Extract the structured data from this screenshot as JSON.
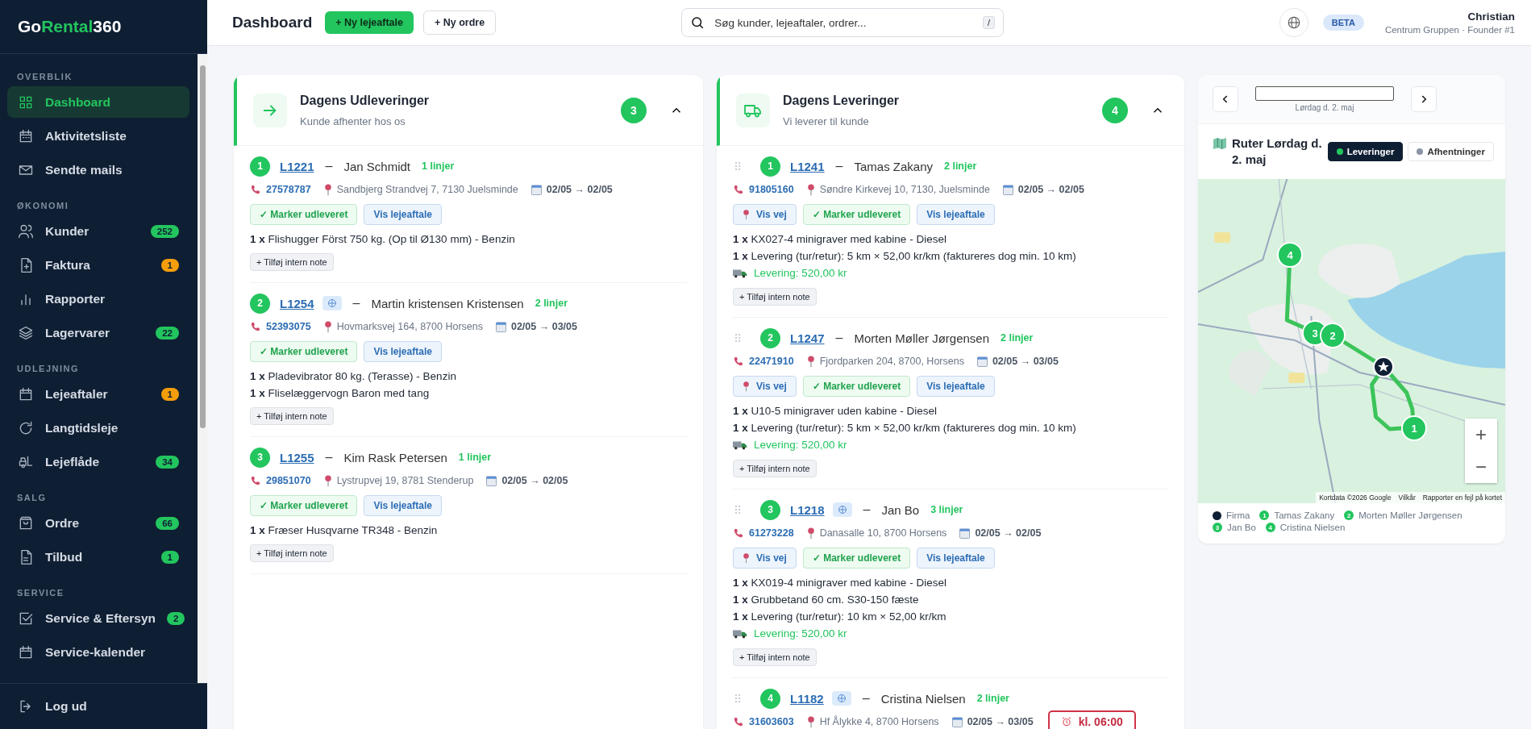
{
  "sidebar": {
    "logo": [
      "Go",
      "Rental",
      "360"
    ],
    "sections": [
      {
        "title": "OVERBLIK",
        "items": [
          {
            "label": "Dashboard",
            "selected": true
          },
          {
            "label": "Aktivitetsliste",
            "selected": false
          },
          {
            "label": "Sendte mails",
            "selected": false
          }
        ]
      },
      {
        "title": "ØKONOMI",
        "items": [
          {
            "label": "Kunder",
            "selected": false,
            "badge": "252",
            "color": "#22c55e"
          },
          {
            "label": "Faktura",
            "selected": false,
            "badge": "1",
            "color": "#f59e0b"
          },
          {
            "label": "Rapporter",
            "selected": false
          },
          {
            "label": "Lagervarer",
            "selected": false,
            "badge": "22",
            "color": "#22c55e"
          }
        ]
      },
      {
        "title": "UDLEJNING",
        "items": [
          {
            "label": "Lejeaftaler",
            "selected": false,
            "badge": "1",
            "color": "#f59e0b"
          },
          {
            "label": "Langtidsleje",
            "selected": false
          },
          {
            "label": "Lejeflåde",
            "selected": false,
            "badge": "34",
            "color": "#22c55e"
          }
        ]
      },
      {
        "title": "SALG",
        "items": [
          {
            "label": "Ordre",
            "selected": false,
            "badge": "66",
            "color": "#22c55e"
          },
          {
            "label": "Tilbud",
            "selected": false,
            "badge": "1",
            "color": "#22c55e"
          }
        ]
      },
      {
        "title": "SERVICE",
        "items": [
          {
            "label": "Service & Eftersyn",
            "selected": false,
            "badge": "2",
            "color": "#22c55e"
          },
          {
            "label": "Service-kalender",
            "selected": false
          }
        ]
      }
    ],
    "logout": "Log ud"
  },
  "header": {
    "title": "Dashboard",
    "primary_button": "+ Ny lejeaftale",
    "secondary_button": "+ Ny ordre",
    "search": {
      "placeholder": "Søg kunder, lejeaftaler, ordrer...",
      "shortcut": "/"
    },
    "badge": "BETA",
    "user": {
      "name": "Christian",
      "org": "Centrum Gruppen · Founder #1"
    }
  },
  "cards": [
    {
      "kind": "pickup",
      "title": "Dagens Udleveringer",
      "subtitle": "Kunde afhenter hos os",
      "count": "3",
      "expanded": true,
      "items": [
        {
          "num": "1",
          "ref": "L1221",
          "web": false,
          "separator": "–",
          "name": "Jan Schmidt",
          "lines": "1 linjer",
          "phone": "27578787",
          "address": "Sandbjerg Strandvej 7, 7130 Juelsminde",
          "dates": "02/05 → 02/05",
          "actions": [
            {
              "kind": "mark",
              "label": "✓ Marker udleveret"
            },
            {
              "kind": "view",
              "label": "Vis lejeaftale"
            }
          ],
          "products": [
            "**1 x** Flishugger Först 750 kg. (Op til Ø130 mm) - Benzin"
          ],
          "note_button": "+ Tilføj intern note"
        },
        {
          "num": "2",
          "ref": "L1254",
          "web": true,
          "separator": "–",
          "name": "Martin kristensen Kristensen",
          "lines": "2 linjer",
          "phone": "52393075",
          "address": "Hovmarksvej 164, 8700 Horsens",
          "dates": "02/05 → 03/05",
          "actions": [
            {
              "kind": "mark",
              "label": "✓ Marker udleveret"
            },
            {
              "kind": "view",
              "label": "Vis lejeaftale"
            }
          ],
          "products": [
            "**1 x** Pladevibrator 80 kg. (Terasse) - Benzin",
            "**1 x** Fliselæggervogn Baron med tang"
          ],
          "note_button": "+ Tilføj intern note"
        },
        {
          "num": "3",
          "ref": "L1255",
          "web": false,
          "separator": "–",
          "name": "Kim Rask Petersen",
          "lines": "1 linjer",
          "phone": "29851070",
          "address": "Lystrupvej 19, 8781 Stenderup",
          "dates": "02/05 → 02/05",
          "actions": [
            {
              "kind": "mark",
              "label": "✓ Marker udleveret"
            },
            {
              "kind": "view",
              "label": "Vis lejeaftale"
            }
          ],
          "products": [
            "**1 x** Fræser Husqvarne TR348 - Benzin"
          ],
          "note_button": "+ Tilføj intern note"
        }
      ]
    },
    {
      "kind": "delivery",
      "title": "Dagens Leveringer",
      "subtitle": "Vi leverer til kunde",
      "count": "4",
      "expanded": true,
      "items": [
        {
          "num": "1",
          "ref": "L1241",
          "web": false,
          "separator": "–",
          "name": "Tamas Zakany",
          "lines": "2 linjer",
          "phone": "91805160",
          "address": "Søndre Kirkevej 10, 7130, Juelsminde",
          "dates": "02/05 → 02/05",
          "actions": [
            {
              "kind": "route",
              "label": "Vis vej"
            },
            {
              "kind": "mark",
              "label": "✓ Marker udleveret"
            },
            {
              "kind": "view",
              "label": "Vis lejeaftale"
            }
          ],
          "products": [
            "**1 x** KX027-4 minigraver med kabine - Diesel",
            "**1 x** Levering (tur/retur): 5 km × 52,00 kr/km (faktureres dog min. 10 km)"
          ],
          "fee": "Levering: 520,00 kr",
          "note_button": "+ Tilføj intern note"
        },
        {
          "num": "2",
          "ref": "L1247",
          "web": false,
          "separator": "–",
          "name": "Morten Møller Jørgensen",
          "lines": "2 linjer",
          "phone": "22471910",
          "address": "Fjordparken 204, 8700, Horsens",
          "dates": "02/05 → 03/05",
          "actions": [
            {
              "kind": "route",
              "label": "Vis vej"
            },
            {
              "kind": "mark",
              "label": "✓ Marker udleveret"
            },
            {
              "kind": "view",
              "label": "Vis lejeaftale"
            }
          ],
          "products": [
            "**1 x** U10-5 minigraver uden kabine - Diesel",
            "**1 x** Levering (tur/retur): 5 km × 52,00 kr/km (faktureres dog min. 10 km)"
          ],
          "fee": "Levering: 520,00 kr",
          "note_button": "+ Tilføj intern note"
        },
        {
          "num": "3",
          "ref": "L1218",
          "web": true,
          "separator": "–",
          "name": "Jan Bo",
          "lines": "3 linjer",
          "phone": "61273228",
          "address": "Danasalle 10, 8700 Horsens",
          "dates": "02/05 → 02/05",
          "actions": [
            {
              "kind": "route",
              "label": "Vis vej"
            },
            {
              "kind": "mark",
              "label": "✓ Marker udleveret"
            },
            {
              "kind": "view",
              "label": "Vis lejeaftale"
            }
          ],
          "products": [
            "**1 x** KX019-4 minigraver med kabine - Diesel",
            "**1 x** Grubbetand 60 cm. S30-150 fæste",
            "**1 x** Levering (tur/retur): 10 km × 52,00 kr/km"
          ],
          "fee": "Levering: 520,00 kr",
          "note_button": "+ Tilføj intern note"
        },
        {
          "num": "4",
          "ref": "L1182",
          "web": true,
          "separator": "–",
          "name": "Cristina Nielsen",
          "lines": "2 linjer",
          "phone": "31603603",
          "address": "Hf Ålykke 4, 8700 Horsens",
          "dates": "02/05 → 03/05",
          "alarm": "kl. 06:00"
        }
      ]
    }
  ],
  "map": {
    "date_caption": "Lørdag d. 2. maj",
    "title": "Ruter Lørdag d. 2. maj",
    "toggles": [
      {
        "label": "Leveringer",
        "selected": true,
        "color": "#22c55e"
      },
      {
        "label": "Afhentninger",
        "selected": false,
        "color": "#8b95a5"
      }
    ],
    "markers": [
      {
        "label": "4"
      },
      {
        "label": "3"
      },
      {
        "label": "2"
      },
      {
        "label": "1"
      }
    ],
    "attribution": [
      "Kortdata ©2026 Google",
      "Vilkår",
      "Rapporter en fejl på kortet"
    ],
    "zoom_in": "+",
    "zoom_out": "−",
    "legend": [
      {
        "kind": "company",
        "label": "Firma"
      },
      {
        "kind": "stop",
        "num": "1",
        "label": "Tamas Zakany"
      },
      {
        "kind": "stop",
        "num": "2",
        "label": "Morten Møller Jørgensen"
      },
      {
        "kind": "stop",
        "num": "3",
        "label": "Jan Bo"
      },
      {
        "kind": "stop",
        "num": "4",
        "label": "Cristina Nielsen"
      }
    ]
  }
}
